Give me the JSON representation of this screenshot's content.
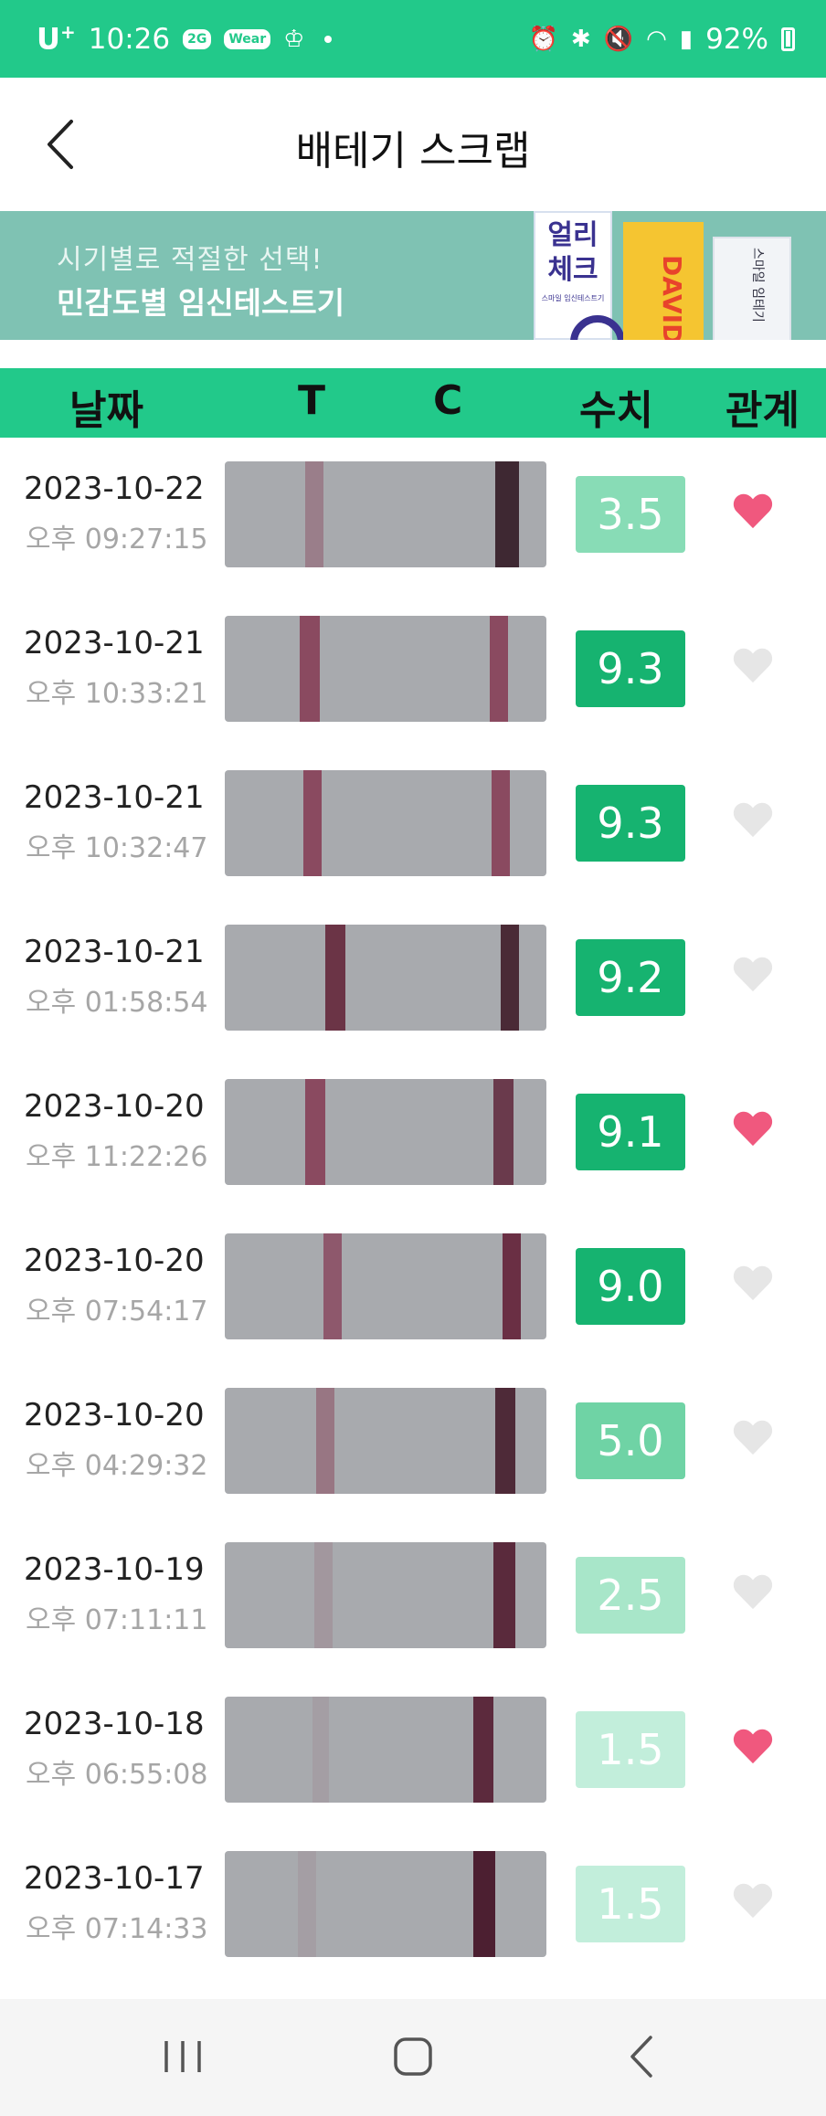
{
  "status_bar": {
    "carrier": "U",
    "carrier_plus": "+",
    "time": "10:26",
    "chip_a": "2G",
    "chip_b": "Wear",
    "battery": "92%"
  },
  "header": {
    "title": "배테기 스크랩"
  },
  "banner": {
    "line1": "시기별로 적절한 선택!",
    "line2": "민감도별 임신테스트기",
    "pack1_text": "얼리\n체크",
    "pack1_sub": "스마일 임신테스트기",
    "pack2_text": "DAVID -SUPER",
    "pack3_text": "스마일 임테기"
  },
  "table_header": {
    "date": "날짜",
    "t": "T",
    "c": "C",
    "value": "수치",
    "relation": "관계"
  },
  "colors": {
    "accent": "#22c98a",
    "heart_on": "#f0587e",
    "heart_off": "#e6e6e6"
  },
  "records": [
    {
      "date": "2023-10-22",
      "time": "오후 09:27:15",
      "value": "3.5",
      "liked": true,
      "badge_color": "#88dcb6"
    },
    {
      "date": "2023-10-21",
      "time": "오후 10:33:21",
      "value": "9.3",
      "liked": false,
      "badge_color": "#16b370"
    },
    {
      "date": "2023-10-21",
      "time": "오후 10:32:47",
      "value": "9.3",
      "liked": false,
      "badge_color": "#16b370"
    },
    {
      "date": "2023-10-21",
      "time": "오후 01:58:54",
      "value": "9.2",
      "liked": false,
      "badge_color": "#16b370"
    },
    {
      "date": "2023-10-20",
      "time": "오후 11:22:26",
      "value": "9.1",
      "liked": true,
      "badge_color": "#16b370"
    },
    {
      "date": "2023-10-20",
      "time": "오후 07:54:17",
      "value": "9.0",
      "liked": false,
      "badge_color": "#16b370"
    },
    {
      "date": "2023-10-20",
      "time": "오후 04:29:32",
      "value": "5.0",
      "liked": false,
      "badge_color": "#6fd3a5"
    },
    {
      "date": "2023-10-19",
      "time": "오후 07:11:11",
      "value": "2.5",
      "liked": false,
      "badge_color": "#a8e6c9"
    },
    {
      "date": "2023-10-18",
      "time": "오후 06:55:08",
      "value": "1.5",
      "liked": true,
      "badge_color": "#c2eedb"
    },
    {
      "date": "2023-10-17",
      "time": "오후 07:14:33",
      "value": "1.5",
      "liked": false,
      "badge_color": "#c2eedb"
    }
  ]
}
